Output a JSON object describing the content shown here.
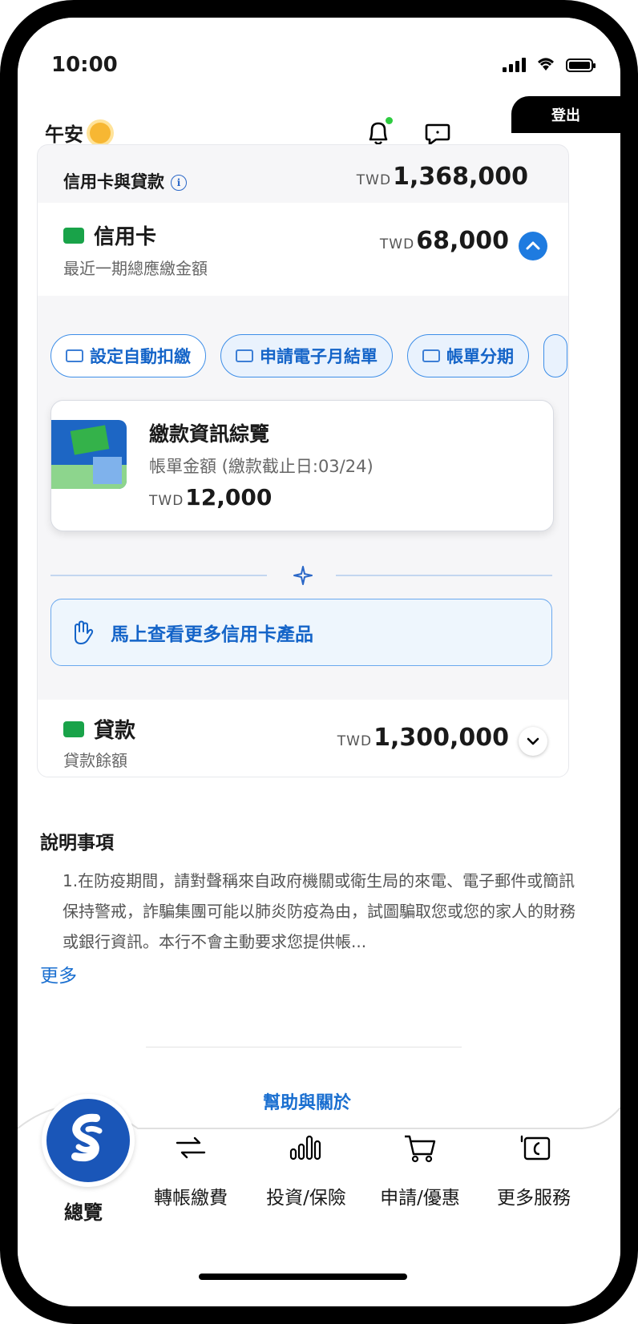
{
  "status_bar": {
    "time": "10:00"
  },
  "header": {
    "greeting": "午安",
    "logout_label": "登出"
  },
  "summary": {
    "label": "信用卡與貸款",
    "currency": "TWD",
    "amount": "1,368,000"
  },
  "credit_card": {
    "title": "信用卡",
    "subtitle": "最近一期總應繳金額",
    "currency": "TWD",
    "amount": "68,000",
    "actions": [
      {
        "label": "設定自動扣繳"
      },
      {
        "label": "申請電子月結單"
      },
      {
        "label": "帳單分期"
      }
    ],
    "payment_card": {
      "title": "繳款資訊綜覽",
      "subtitle": "帳單金額 (繳款截止日:03/24)",
      "currency": "TWD",
      "amount": "12,000"
    },
    "promo": "馬上查看更多信用卡產品"
  },
  "loan": {
    "title": "貸款",
    "subtitle": "貸款餘額",
    "currency": "TWD",
    "amount": "1,300,000"
  },
  "notes": {
    "title": "說明事項",
    "body": "1.在防疫期間，請對聲稱來自政府機關或衛生局的來電、電子郵件或簡訊保持警戒，詐騙集團可能以肺炎防疫為由，試圖騙取您或您的家人的財務或銀行資訊。本行不會主動要求您提供帳...",
    "more": "更多",
    "help": "幫助與關於"
  },
  "tabbar": {
    "home": "總覽",
    "tabs": [
      {
        "label": "轉帳繳費",
        "icon": "transfer-icon"
      },
      {
        "label": "投資/保險",
        "icon": "chart-icon"
      },
      {
        "label": "申請/優惠",
        "icon": "cart-icon"
      },
      {
        "label": "更多服務",
        "icon": "more-services-icon"
      }
    ]
  },
  "colors": {
    "accent": "#1e7be0",
    "brand": "#1a56b8",
    "link": "#1a6fd0",
    "success": "#19a349"
  }
}
